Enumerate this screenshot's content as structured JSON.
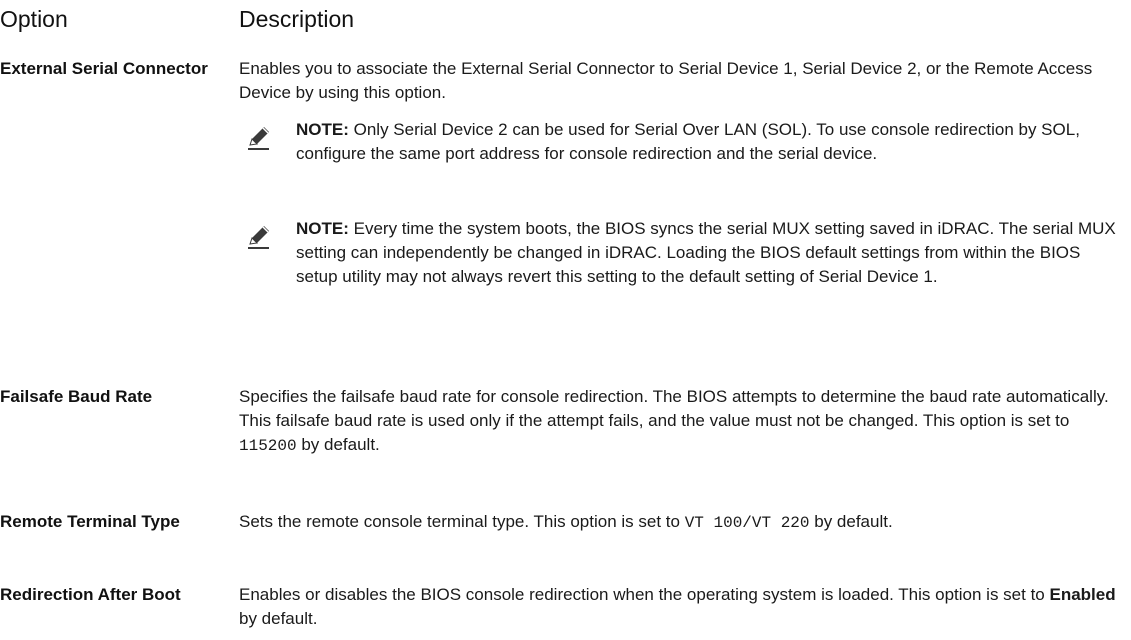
{
  "header": {
    "option": "Option",
    "description": "Description"
  },
  "rows": [
    {
      "option": "External Serial Connector",
      "description": "Enables you to associate the External Serial Connector to Serial Device 1, Serial Device 2, or the Remote Access Device by using this option.",
      "notes": [
        {
          "label": "NOTE:",
          "text": "Only Serial Device 2 can be used for Serial Over LAN (SOL). To use console redirection by SOL, configure the same port address for console redirection and the serial device."
        },
        {
          "label": "NOTE:",
          "text": "Every time the system boots, the BIOS syncs the serial MUX setting saved in iDRAC. The serial MUX setting can independently be changed in iDRAC. Loading the BIOS default settings from within the BIOS setup utility may not always revert this setting to the default setting of Serial Device 1."
        }
      ]
    },
    {
      "option": "Failsafe Baud Rate",
      "description_pre": "Specifies the failsafe baud rate for console redirection. The BIOS attempts to determine the baud rate automatically. This failsafe baud rate is used only if the attempt fails, and the value must not be changed. This option is set to ",
      "description_code": "115200",
      "description_post": " by default."
    },
    {
      "option": "Remote Terminal Type",
      "description_pre": "Sets the remote console terminal type. This option is set to ",
      "description_code": "VT 100/VT 220",
      "description_post": " by default."
    },
    {
      "option": "Redirection After Boot",
      "description_pre": "Enables or disables the BIOS console redirection when the operating system is loaded. This option is set to ",
      "description_bold": "Enabled",
      "description_post": " by default."
    }
  ],
  "icons": {
    "note": "pencil-note-icon"
  },
  "colors": {
    "text": "#1a1a1a",
    "icon": "#3a3a3a"
  }
}
